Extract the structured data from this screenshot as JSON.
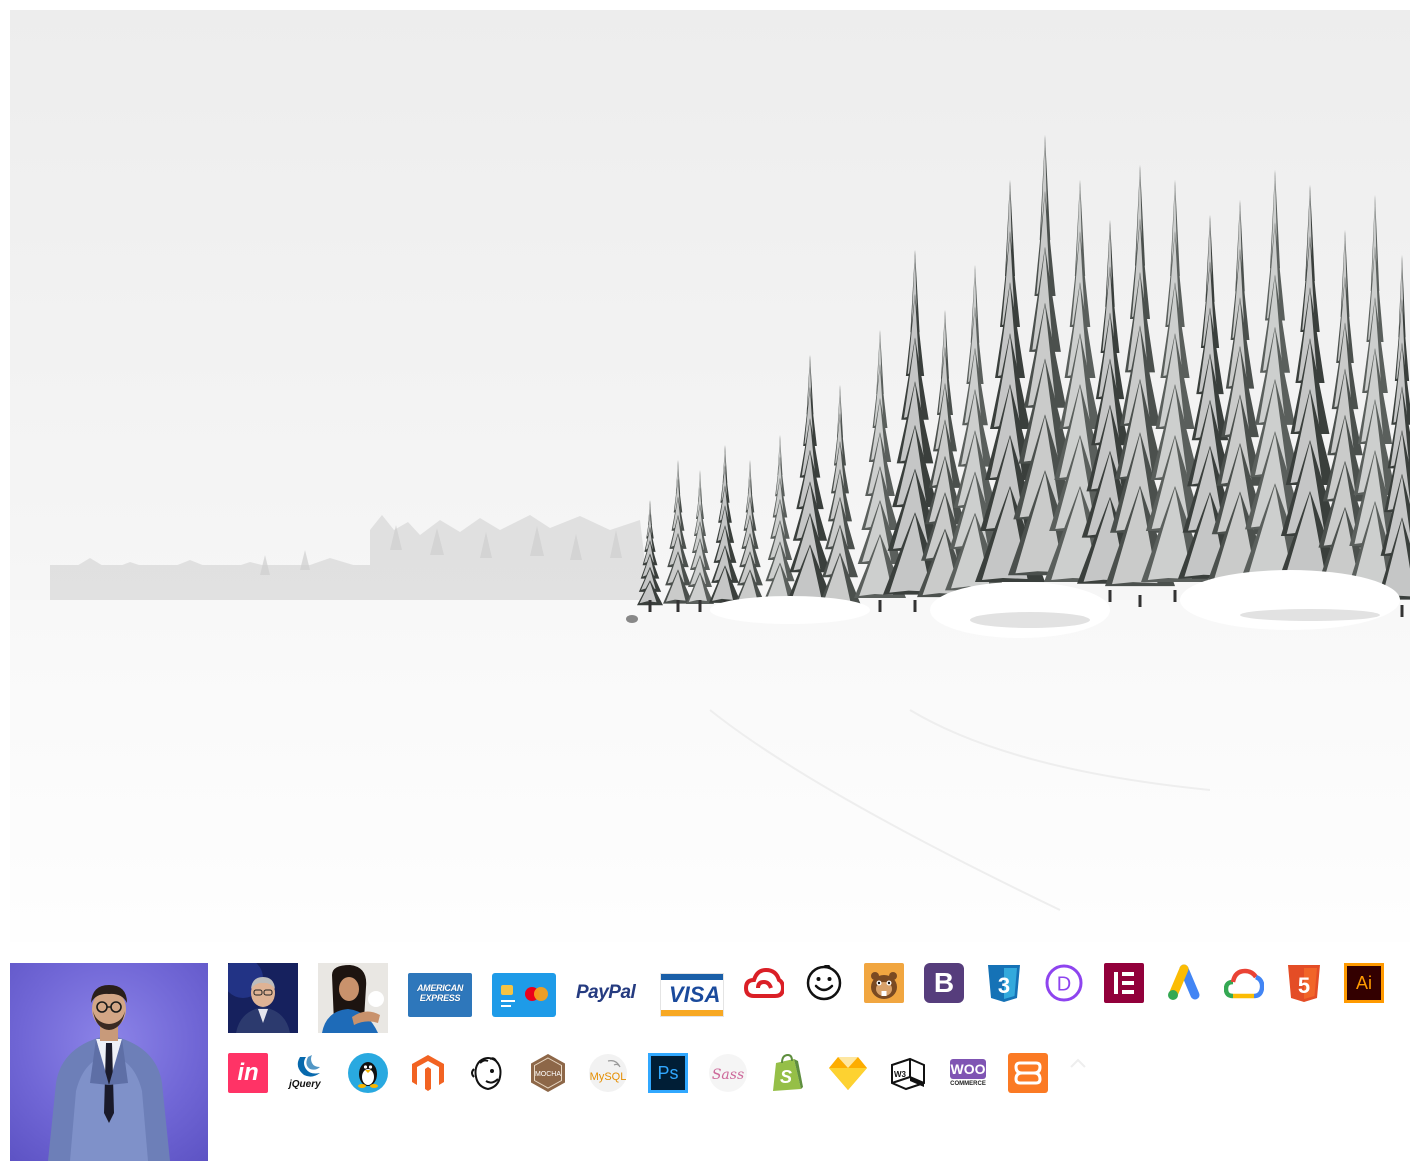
{
  "hero": {
    "icon": "snowy-forest-landscape-photo"
  },
  "profile": {
    "icon": "profile-photo-man-in-suit",
    "bg_color": "#7167d6"
  },
  "row1": [
    {
      "name": "avatar-man-photo-icon",
      "kind": "photo"
    },
    {
      "name": "avatar-woman-photo-icon",
      "kind": "photo"
    },
    {
      "name": "american-express-icon",
      "text_line1": "AMERICAN",
      "text_line2": "EXPRESS",
      "color": "#2e77bb"
    },
    {
      "name": "credit-card-mastercard-icon",
      "color": "#1e9be8"
    },
    {
      "name": "paypal-icon",
      "text": "PayPal",
      "color": "#253b80"
    },
    {
      "name": "visa-icon",
      "text": "VISA",
      "color": "#1a1f71"
    },
    {
      "name": "adobe-creative-cloud-icon",
      "color": "#da1f26"
    },
    {
      "name": "smiley-face-icon",
      "color": "#111111"
    },
    {
      "name": "beaver-builder-icon",
      "color": "#f1a640"
    },
    {
      "name": "bootstrap-icon",
      "text": "B",
      "color": "#563d7c"
    },
    {
      "name": "css3-icon",
      "text": "3",
      "color": "#1572b6"
    },
    {
      "name": "divi-icon",
      "text": "D",
      "color": "#8e44ef"
    },
    {
      "name": "elementor-icon",
      "color": "#92003b"
    },
    {
      "name": "google-ads-icon",
      "color": "#4285f4"
    },
    {
      "name": "google-cloud-icon",
      "color": "#4285f4"
    },
    {
      "name": "html5-icon",
      "text": "5",
      "color": "#e44d26"
    },
    {
      "name": "adobe-illustrator-icon",
      "text": "Ai",
      "color": "#ff9a00"
    }
  ],
  "row2": [
    {
      "name": "invision-icon",
      "text": "in",
      "color": "#ff3366"
    },
    {
      "name": "jquery-icon",
      "text": "jQuery",
      "color": "#0769ad"
    },
    {
      "name": "linux-tux-icon",
      "color": "#29a9e0"
    },
    {
      "name": "magento-icon",
      "color": "#f26322"
    },
    {
      "name": "mailchimp-icon",
      "color": "#111111"
    },
    {
      "name": "mocha-icon",
      "text": "MOCHA",
      "color": "#8d6748"
    },
    {
      "name": "mysql-icon",
      "text": "MySQL",
      "color": "#00758f"
    },
    {
      "name": "photoshop-icon",
      "text": "Ps",
      "color": "#31a8ff"
    },
    {
      "name": "sass-icon",
      "text": "Sass",
      "color": "#cd6799"
    },
    {
      "name": "shopify-icon",
      "color": "#95bf47"
    },
    {
      "name": "sketch-icon",
      "color": "#fdad00"
    },
    {
      "name": "w3c-cube-icon",
      "text": "W3",
      "color": "#111111"
    },
    {
      "name": "woocommerce-icon",
      "text_line1": "WOO",
      "text_line2": "COMMERCE",
      "color": "#7f54b3"
    },
    {
      "name": "xampp-icon",
      "color": "#fb7a24"
    },
    {
      "name": "chevron-up-icon",
      "color": "#eeeeee"
    }
  ]
}
